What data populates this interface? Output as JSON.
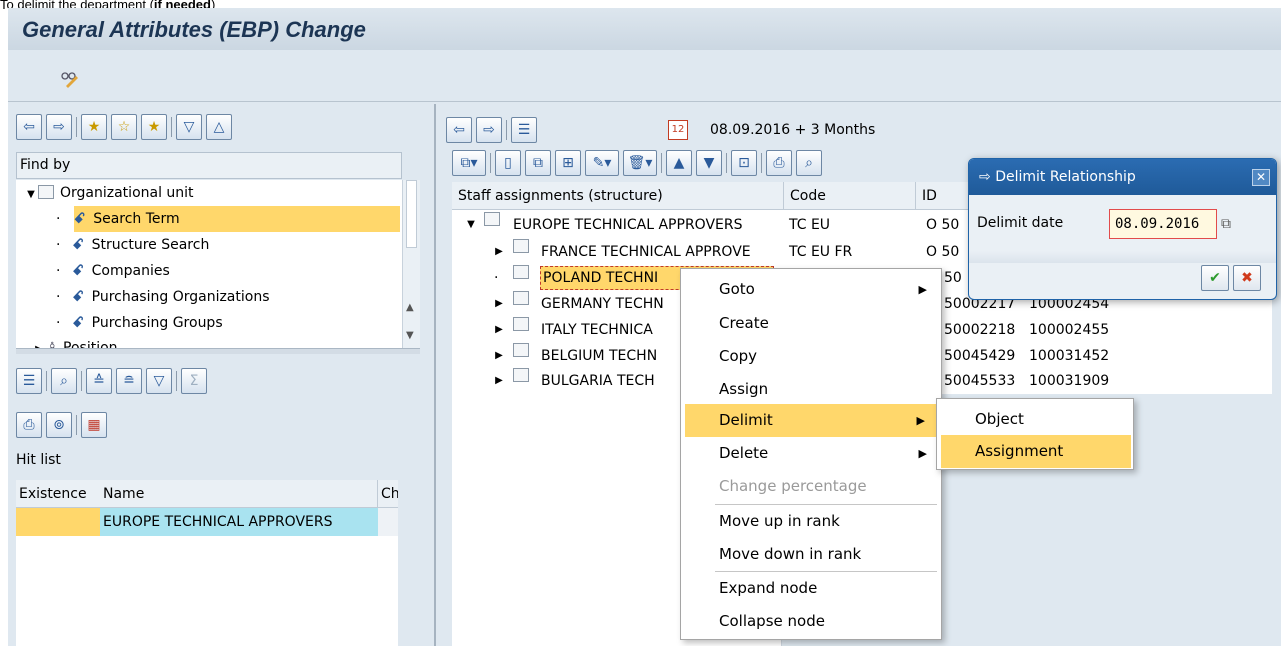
{
  "caption": {
    "pre": "To delimit the department (",
    "bold": "if needed",
    "post": ")"
  },
  "app": {
    "title": "General Attributes (EBP) Change"
  },
  "colors": {
    "accent": "#1f63a8",
    "selection": "#ffd76b",
    "hit_highlight": "#a9e3f0"
  },
  "left": {
    "find_by": "Find by",
    "tree": [
      {
        "label": "Organizational unit",
        "icon": "checkbox"
      },
      {
        "label": "Search Term",
        "icon": "binoculars-icon"
      },
      {
        "label": "Structure Search",
        "icon": "binoculars-icon"
      },
      {
        "label": "Companies",
        "icon": "binoculars-icon"
      },
      {
        "label": "Purchasing Organizations",
        "icon": "binoculars-icon"
      },
      {
        "label": "Purchasing Groups",
        "icon": "binoculars-icon"
      },
      {
        "label": "Position",
        "icon": "person-icon"
      }
    ],
    "hit_list": "Hit list",
    "hit_cols": [
      "Existence",
      "Name",
      "Chi..."
    ],
    "hit_rows": [
      {
        "name": "EUROPE TECHNICAL APPROVERS"
      }
    ]
  },
  "right": {
    "date_text": "08.09.2016  + 3 Months",
    "cols": [
      "Staff assignments (structure)",
      "Code",
      "ID"
    ],
    "rows": [
      {
        "name": "EUROPE TECHNICAL APPROVERS",
        "code": "TC EU",
        "id": "O 50",
        "id2": ""
      },
      {
        "name": "FRANCE TECHNICAL APPROVE",
        "code": "TC EU FR",
        "id": "O 50",
        "id2": ""
      },
      {
        "name": "POLAND TECHNI",
        "code": "",
        "id": "50",
        "id2": ""
      },
      {
        "name": "GERMANY TECHN",
        "code": "",
        "id": "50002217",
        "id2": "100002454"
      },
      {
        "name": "ITALY TECHNICA",
        "code": "",
        "id": "50002218",
        "id2": "100002455"
      },
      {
        "name": "BELGIUM TECHN",
        "code": "",
        "id": "50045429",
        "id2": "100031452"
      },
      {
        "name": "BULGARIA TECH",
        "code": "",
        "id": "50045533",
        "id2": "100031909"
      }
    ]
  },
  "context_menu": {
    "items": [
      "Goto",
      "Create",
      "Copy",
      "Assign",
      "Delimit",
      "Delete",
      "Change percentage",
      "Move up in rank",
      "Move down in rank",
      "Expand node",
      "Collapse node"
    ],
    "submenu": [
      "Object",
      "Assignment"
    ]
  },
  "dialog": {
    "title": "Delimit Relationship",
    "label": "Delimit date",
    "value": "08.09.2016"
  }
}
